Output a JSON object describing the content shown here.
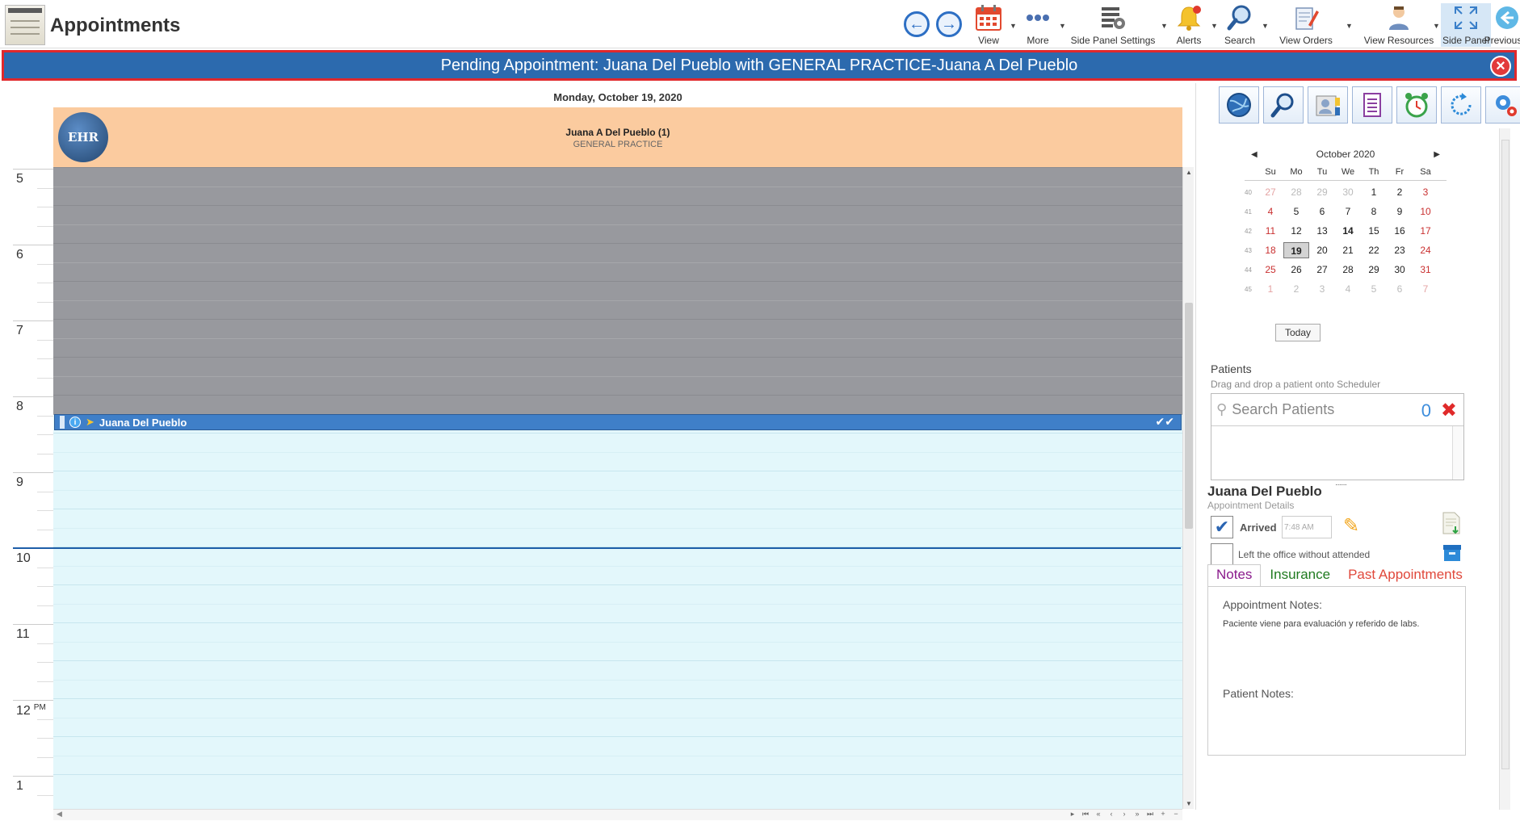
{
  "app": {
    "title": "Appointments"
  },
  "toolbar": {
    "items": [
      {
        "label": "View",
        "icon": "calendar-icon"
      },
      {
        "label": "More",
        "icon": "more-icon"
      },
      {
        "label": "Side Panel Settings",
        "icon": "panel-settings-icon"
      },
      {
        "label": "Alerts",
        "icon": "bell-icon"
      },
      {
        "label": "Search",
        "icon": "search-icon"
      },
      {
        "label": "View Orders",
        "icon": "orders-icon"
      },
      {
        "label": "View Resources",
        "icon": "resources-icon"
      },
      {
        "label": "Side Panel",
        "icon": "expand-icon"
      },
      {
        "label": "Previous",
        "icon": "back-icon"
      }
    ]
  },
  "banner": {
    "text": "Pending Appointment: Juana Del Pueblo with GENERAL PRACTICE-Juana A Del Pueblo"
  },
  "scheduler": {
    "date": "Monday, October 19, 2020",
    "resource": {
      "name": "Juana A Del Pueblo (1)",
      "specialty": "GENERAL PRACTICE",
      "logo_text": "EHR"
    },
    "hours": [
      "5",
      "6",
      "7",
      "8",
      "9",
      "10",
      "11",
      "12",
      "1"
    ],
    "pm_marker": "PM",
    "appointment": {
      "patient": "Juana Del Pueblo",
      "info_glyph": "i",
      "checks": "✔✔"
    }
  },
  "calendar": {
    "month_label": "October 2020",
    "day_names": [
      "Su",
      "Mo",
      "Tu",
      "We",
      "Th",
      "Fr",
      "Sa"
    ],
    "weeks": [
      {
        "week": "40",
        "days": [
          "27",
          "28",
          "29",
          "30",
          "1",
          "2",
          "3"
        ]
      },
      {
        "week": "41",
        "days": [
          "4",
          "5",
          "6",
          "7",
          "8",
          "9",
          "10"
        ]
      },
      {
        "week": "42",
        "days": [
          "11",
          "12",
          "13",
          "14",
          "15",
          "16",
          "17"
        ]
      },
      {
        "week": "43",
        "days": [
          "18",
          "19",
          "20",
          "21",
          "22",
          "23",
          "24"
        ]
      },
      {
        "week": "44",
        "days": [
          "25",
          "26",
          "27",
          "28",
          "29",
          "30",
          "31"
        ]
      },
      {
        "week": "45",
        "days": [
          "1",
          "2",
          "3",
          "4",
          "5",
          "6",
          "7"
        ]
      }
    ],
    "today_label": "Today"
  },
  "patients": {
    "title": "Patients",
    "hint": "Drag and drop a patient onto Scheduler",
    "search_placeholder": "Search Patients",
    "count": "0"
  },
  "details": {
    "patient_name": "Juana Del Pueblo",
    "subtitle": "Appointment Details",
    "arrived_label": "Arrived",
    "arrived_time": "7:48 AM",
    "left_office_label": "Left the office without attended"
  },
  "tabs": [
    {
      "label": "Notes",
      "color": "#8a1a8c"
    },
    {
      "label": "Insurance",
      "color": "#1f7a1f"
    },
    {
      "label": "Past Appointments",
      "color": "#e0483b"
    }
  ],
  "notes": {
    "appointment_title": "Appointment Notes:",
    "appointment_text": "Paciente viene para evaluación y referido de labs.",
    "patient_title": "Patient Notes:"
  },
  "colors": {
    "banner_bg": "#2c6aae",
    "banner_border": "#e0282c",
    "resource_header": "#fbcb9f",
    "closed_hours": "#98999e",
    "open_hours": "#e3f7fb",
    "appointment": "#3f7fc8"
  }
}
